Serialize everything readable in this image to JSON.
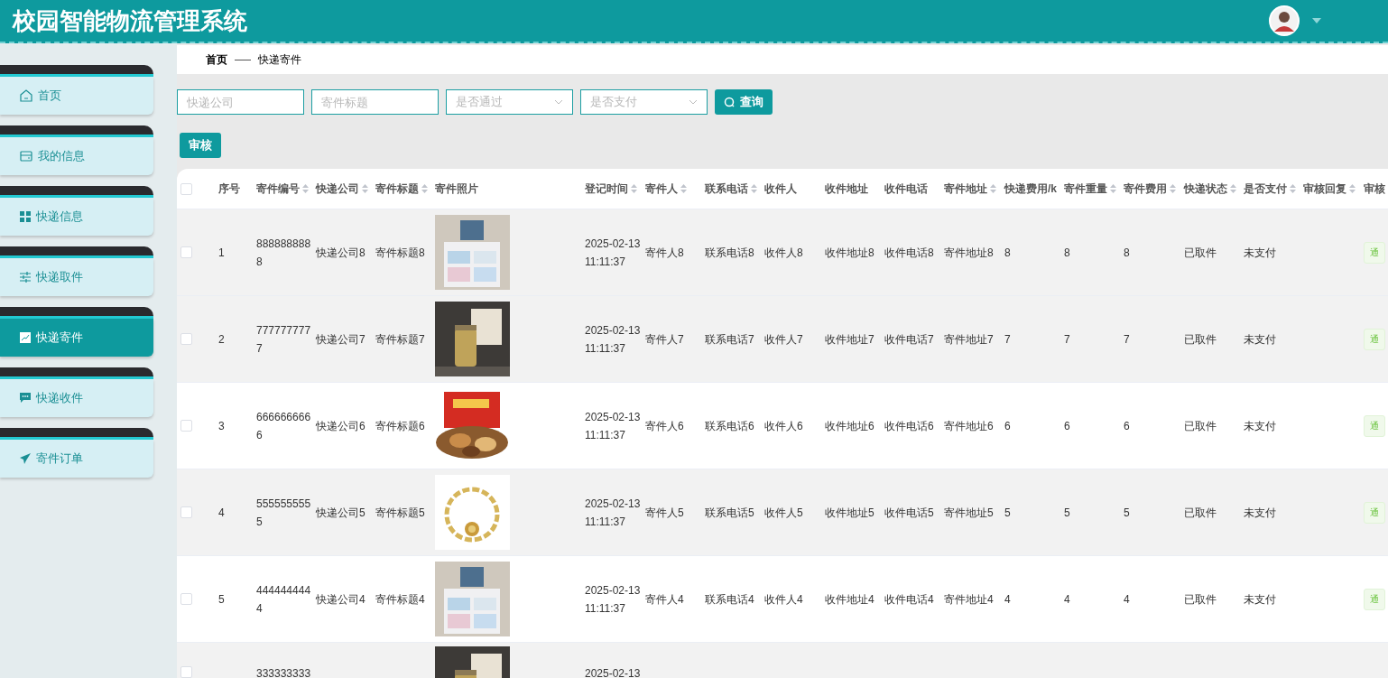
{
  "header": {
    "title": "校园智能物流管理系统"
  },
  "sidebar": {
    "items": [
      {
        "label": "首页",
        "selected": false
      },
      {
        "label": "我的信息",
        "selected": false
      },
      {
        "label": "快递信息",
        "selected": false
      },
      {
        "label": "快递取件",
        "selected": false
      },
      {
        "label": "快递寄件",
        "selected": true
      },
      {
        "label": "快递收件",
        "selected": false
      },
      {
        "label": "寄件订单",
        "selected": false
      }
    ]
  },
  "breadcrumb": [
    "首页",
    "快递寄件"
  ],
  "filters": [
    {
      "kind": "input",
      "placeholder": "快递公司"
    },
    {
      "kind": "input",
      "placeholder": "寄件标题"
    },
    {
      "kind": "select",
      "placeholder": "是否通过"
    },
    {
      "kind": "select",
      "placeholder": "是否支付"
    }
  ],
  "search_button": "查询",
  "audit_button": "审核",
  "table": {
    "all_checked": false,
    "columns": [
      {
        "label": "序号",
        "sortable": false
      },
      {
        "label": "寄件编号",
        "sortable": true
      },
      {
        "label": "快递公司",
        "sortable": true
      },
      {
        "label": "寄件标题",
        "sortable": true
      },
      {
        "label": "寄件照片",
        "sortable": false
      },
      {
        "label": "登记时间",
        "sortable": true
      },
      {
        "label": "寄件人",
        "sortable": true
      },
      {
        "label": "联系电话",
        "sortable": true
      },
      {
        "label": "收件人",
        "sortable": false
      },
      {
        "label": "收件地址",
        "sortable": false
      },
      {
        "label": "收件电话",
        "sortable": false
      },
      {
        "label": "寄件地址",
        "sortable": true
      },
      {
        "label": "快递费用/k"
      },
      {
        "label": "寄件重量",
        "sortable": true
      },
      {
        "label": "寄件费用",
        "sortable": true
      },
      {
        "label": "快递状态",
        "sortable": true
      },
      {
        "label": "是否支付",
        "sortable": true
      },
      {
        "label": "审核回复",
        "sortable": true
      },
      {
        "label": "审核"
      }
    ],
    "rows": [
      {
        "checked": false,
        "hovered": true,
        "cells": [
          "1",
          "8888888888",
          "快递公司8",
          "寄件标题8",
          {
            "kind": "picture"
          },
          "2025-02-13 11:11:37",
          "寄件人8",
          "联系电话8",
          "收件人8",
          "收件地址8",
          "收件电话8",
          "寄件地址8",
          "8",
          "8",
          "8",
          "已取件",
          "未支付",
          "",
          "通"
        ]
      },
      {
        "checked": false,
        "hovered": true,
        "cells": [
          "2",
          "7777777777",
          "快递公司7",
          "寄件标题7",
          {
            "kind": "picture"
          },
          "2025-02-13 11:11:37",
          "寄件人7",
          "联系电话7",
          "收件人7",
          "收件地址7",
          "收件电话7",
          "寄件地址7",
          "7",
          "7",
          "7",
          "已取件",
          "未支付",
          "",
          "通"
        ]
      },
      {
        "checked": false,
        "hovered": false,
        "cells": [
          "3",
          "6666666666",
          "快递公司6",
          "寄件标题6",
          {
            "kind": "picture"
          },
          "2025-02-13 11:11:37",
          "寄件人6",
          "联系电话6",
          "收件人6",
          "收件地址6",
          "收件电话6",
          "寄件地址6",
          "6",
          "6",
          "6",
          "已取件",
          "未支付",
          "",
          "通"
        ]
      },
      {
        "checked": false,
        "hovered": true,
        "cells": [
          "4",
          "5555555555",
          "快递公司5",
          "寄件标题5",
          {
            "kind": "picture"
          },
          "2025-02-13 11:11:37",
          "寄件人5",
          "联系电话5",
          "收件人5",
          "收件地址5",
          "收件电话5",
          "寄件地址5",
          "5",
          "5",
          "5",
          "已取件",
          "未支付",
          "",
          "通"
        ]
      },
      {
        "checked": false,
        "hovered": false,
        "cells": [
          "5",
          "4444444444",
          "快递公司4",
          "寄件标题4",
          {
            "kind": "picture"
          },
          "2025-02-13 11:11:37",
          "寄件人4",
          "联系电话4",
          "收件人4",
          "收件地址4",
          "收件电话4",
          "寄件地址4",
          "4",
          "4",
          "4",
          "已取件",
          "未支付",
          "",
          "通"
        ]
      },
      {
        "checked": false,
        "hovered": true,
        "cells": [
          "",
          "333333333",
          "",
          "",
          {
            "kind": "picture"
          },
          "2025-02-13",
          "",
          "",
          "",
          "",
          "",
          "",
          "",
          "",
          "",
          "",
          "",
          "",
          ""
        ]
      }
    ]
  }
}
